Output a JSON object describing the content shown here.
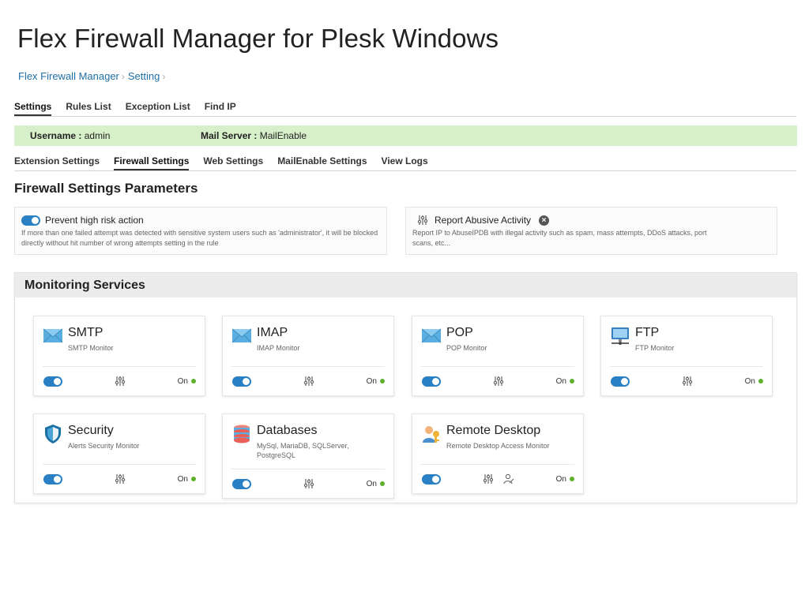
{
  "page_title": "Flex Firewall Manager for Plesk Windows",
  "breadcrumb": [
    "Flex Firewall Manager",
    "Setting"
  ],
  "top_tabs": [
    {
      "label": "Settings",
      "active": true
    },
    {
      "label": "Rules List",
      "active": false
    },
    {
      "label": "Exception List",
      "active": false
    },
    {
      "label": "Find IP",
      "active": false
    }
  ],
  "info_bar": {
    "username_label": "Username :",
    "username_value": "admin",
    "mail_label": "Mail Server :",
    "mail_value": "MailEnable",
    "color": "#d7f0c9"
  },
  "sub_tabs": [
    {
      "label": "Extension Settings",
      "active": false
    },
    {
      "label": "Firewall Settings",
      "active": true
    },
    {
      "label": "Web Settings",
      "active": false
    },
    {
      "label": "MailEnable Settings",
      "active": false
    },
    {
      "label": "View Logs",
      "active": false
    }
  ],
  "section_title": "Firewall Settings Parameters",
  "params": {
    "prevent": {
      "label": "Prevent high risk action",
      "description": "If more than one failed attempt was detected with sensitive system users such as 'administrator', it will be blocked directly without hit number of wrong attempts setting in the rule",
      "enabled": true
    },
    "report": {
      "label": "Report Abusive Activity",
      "description": "Report IP to AbuseIPDB with illegal activity such as spam, mass attempts, DDoS attacks, port scans, etc..."
    }
  },
  "monitoring": {
    "title": "Monitoring Services",
    "services": [
      {
        "name": "SMTP",
        "desc": "SMTP Monitor",
        "state": "On",
        "icon": "envelope-icon"
      },
      {
        "name": "IMAP",
        "desc": "IMAP Monitor",
        "state": "On",
        "icon": "envelope-icon"
      },
      {
        "name": "POP",
        "desc": "POP Monitor",
        "state": "On",
        "icon": "envelope-icon"
      },
      {
        "name": "FTP",
        "desc": "FTP Monitor",
        "state": "On",
        "icon": "network-computer-icon"
      },
      {
        "name": "Security",
        "desc": "Alerts Security Monitor",
        "state": "On",
        "icon": "shield-icon"
      },
      {
        "name": "Databases",
        "desc": "MySql, MariaDB, SQLServer, PostgreSQL",
        "state": "On",
        "icon": "database-icon"
      },
      {
        "name": "Remote Desktop",
        "desc": "Remote Desktop Access Monitor",
        "state": "On",
        "icon": "user-key-icon"
      }
    ]
  },
  "colors": {
    "accent": "#2980c4",
    "link": "#1f6fa6",
    "on_dot": "#5cb02c"
  }
}
